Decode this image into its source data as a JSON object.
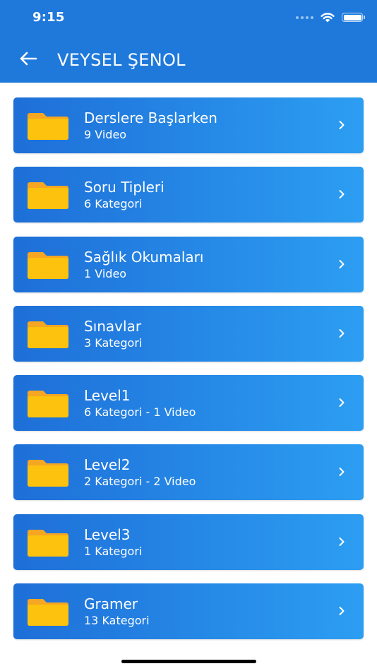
{
  "status_bar": {
    "time": "9:15"
  },
  "nav": {
    "title": "VEYSEL ŞENOL",
    "back_icon": "arrow-left-icon"
  },
  "colors": {
    "header": "#1f79db",
    "card_start": "#1e6fd8",
    "card_end": "#2c9ef2",
    "folder": "#fcc20d",
    "folder_tab": "#f5a623"
  },
  "items": [
    {
      "title": "Derslere Başlarken",
      "subtitle": "9 Video"
    },
    {
      "title": "Soru Tipleri",
      "subtitle": "6 Kategori"
    },
    {
      "title": "Sağlık Okumaları",
      "subtitle": "1 Video"
    },
    {
      "title": "Sınavlar",
      "subtitle": "3 Kategori"
    },
    {
      "title": "Level1",
      "subtitle": "6 Kategori - 1 Video"
    },
    {
      "title": "Level2",
      "subtitle": "2 Kategori - 2 Video"
    },
    {
      "title": "Level3",
      "subtitle": "1 Kategori"
    },
    {
      "title": "Gramer",
      "subtitle": "13 Kategori"
    }
  ]
}
